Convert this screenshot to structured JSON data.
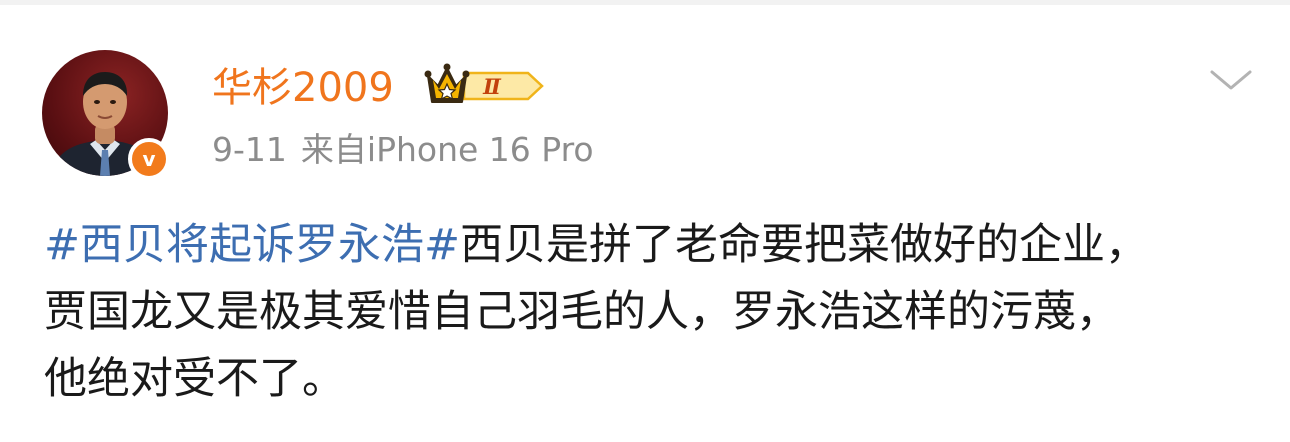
{
  "post": {
    "author": {
      "name": "华杉2009",
      "level_badge": "Ⅱ",
      "verified_mark": "v"
    },
    "meta": {
      "time": "9-11",
      "source": "来自iPhone 16 Pro"
    },
    "body": {
      "hashtag": "#西贝将起诉罗永浩#",
      "line1_rest": "西贝是拼了老命要把菜做好的企业，",
      "line2": "贾国龙又是极其爱惜自己羽毛的人，罗永浩这样的污蔑，",
      "line3": "他绝对受不了。"
    }
  },
  "colors": {
    "username": "#f0751d",
    "hashtag": "#3d6eb1",
    "meta": "#8c8c8c",
    "text": "#1a1a1a",
    "verified_badge": "#f27b1c",
    "crown_gold": "#f5b400"
  },
  "icons": {
    "avatar": "user-avatar",
    "verified": "verified-v-icon",
    "level": "crown-level-badge-icon",
    "more": "chevron-down-icon"
  }
}
